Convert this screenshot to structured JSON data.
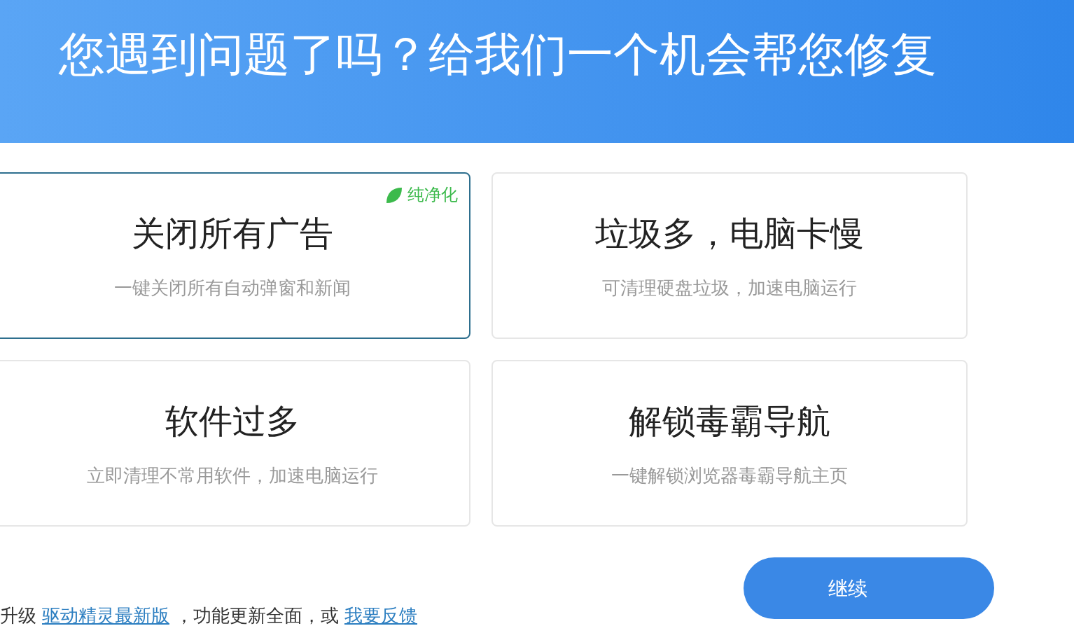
{
  "header": {
    "title": "您遇到问题了吗？给我们一个机会帮您修复"
  },
  "options": [
    {
      "title": "关闭所有广告",
      "description": "一键关闭所有自动弹窗和新闻",
      "selected": true,
      "badge": "纯净化"
    },
    {
      "title": "垃圾多，电脑卡慢",
      "description": "可清理硬盘垃圾，加速电脑运行",
      "selected": false
    },
    {
      "title": "软件过多",
      "description": "立即清理不常用软件，加速电脑运行",
      "selected": false
    },
    {
      "title": "解锁毒霸导航",
      "description": "一键解锁浏览器毒霸导航主页",
      "selected": false
    }
  ],
  "footer": {
    "parts": [
      {
        "kind": "text",
        "text": "升级"
      },
      {
        "kind": "link",
        "text": "驱动精灵最新版"
      },
      {
        "kind": "text",
        "text": "，功能更新全面，或"
      },
      {
        "kind": "link",
        "text": "我要反馈"
      }
    ]
  },
  "continue_button": {
    "label": "继续"
  }
}
